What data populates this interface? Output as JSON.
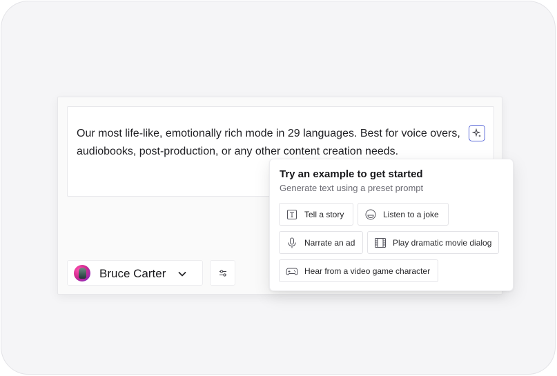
{
  "editor": {
    "text": "Our most life-like, emotionally rich mode in 29 languages. Best for voice overs, audiobooks, post-production, or any other content creation needs.",
    "magic_icon": "sparkle-icon"
  },
  "voice": {
    "name": "Bruce Carter",
    "chevron_icon": "chevron-down-icon",
    "avatar": "avatar"
  },
  "settings": {
    "icon": "sliders-icon"
  },
  "examples": {
    "title": "Try an example to get started",
    "subtitle": "Generate text using a preset prompt",
    "chips": [
      {
        "label": "Tell a story",
        "icon": "text-icon"
      },
      {
        "label": "Listen to a joke",
        "icon": "smile-icon"
      },
      {
        "label": "Narrate an ad",
        "icon": "microphone-icon"
      },
      {
        "label": "Play dramatic movie dialog",
        "icon": "film-icon"
      },
      {
        "label": "Hear from a video game character",
        "icon": "gamepad-icon"
      }
    ]
  },
  "colors": {
    "accent": "#5b6ad8",
    "background": "#f5f5f7",
    "card": "#fafafa"
  }
}
